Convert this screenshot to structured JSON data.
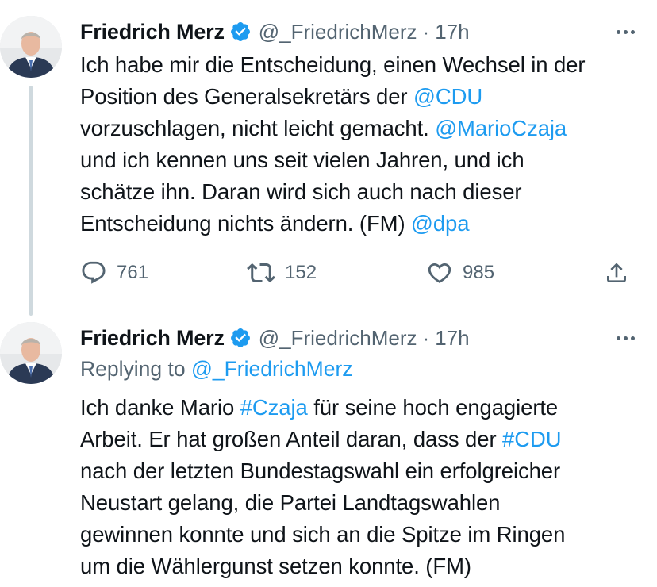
{
  "tweets": [
    {
      "author": {
        "name": "Friedrich Merz",
        "handle": "@_FriedrichMerz",
        "separator": "·",
        "time": "17h",
        "verified": true
      },
      "lines": [
        [
          {
            "text": "Ich habe mir die Entscheidung, einen Wechsel in der"
          }
        ],
        [
          {
            "text": "Position des Generalsekretärs der "
          },
          {
            "text": "@CDU",
            "link": true
          }
        ],
        [
          {
            "text": "vorzuschlagen, nicht leicht gemacht. "
          },
          {
            "text": "@MarioCzaja",
            "link": true
          }
        ],
        [
          {
            "text": "und ich kennen uns seit vielen Jahren, und ich"
          }
        ],
        [
          {
            "text": "schätze ihn. Daran wird sich auch nach dieser"
          }
        ],
        [
          {
            "text": "Entscheidung nichts ändern. (FM) "
          },
          {
            "text": "@dpa",
            "link": true
          }
        ]
      ],
      "stats": {
        "replies": "761",
        "retweets": "152",
        "likes": "985"
      }
    },
    {
      "author": {
        "name": "Friedrich Merz",
        "handle": "@_FriedrichMerz",
        "separator": "·",
        "time": "17h",
        "verified": true
      },
      "replying_to": {
        "prefix": "Replying to ",
        "handle": "@_FriedrichMerz"
      },
      "lines": [
        [
          {
            "text": "Ich danke Mario "
          },
          {
            "text": "#Czaja",
            "link": true
          },
          {
            "text": " für seine hoch engagierte"
          }
        ],
        [
          {
            "text": "Arbeit. Er hat großen Anteil daran, dass der "
          },
          {
            "text": "#CDU",
            "link": true
          }
        ],
        [
          {
            "text": "nach der letzten Bundestagswahl ein erfolgreicher"
          }
        ],
        [
          {
            "text": "Neustart gelang, die Partei Landtagswahlen"
          }
        ],
        [
          {
            "text": "gewinnen konnte und sich an die Spitze im Ringen"
          }
        ],
        [
          {
            "text": "um die Wählergunst setzen konnte. (FM)"
          }
        ]
      ]
    }
  ],
  "colors": {
    "link": "#1d9bf0",
    "secondary": "#536471",
    "verified": "#1d9bf0",
    "thread_line": "#cfd9de"
  },
  "icons": {
    "reply": "reply-icon",
    "retweet": "retweet-icon",
    "like": "heart-icon",
    "share": "share-icon",
    "more": "more-icon",
    "verified": "verified-badge-icon"
  }
}
